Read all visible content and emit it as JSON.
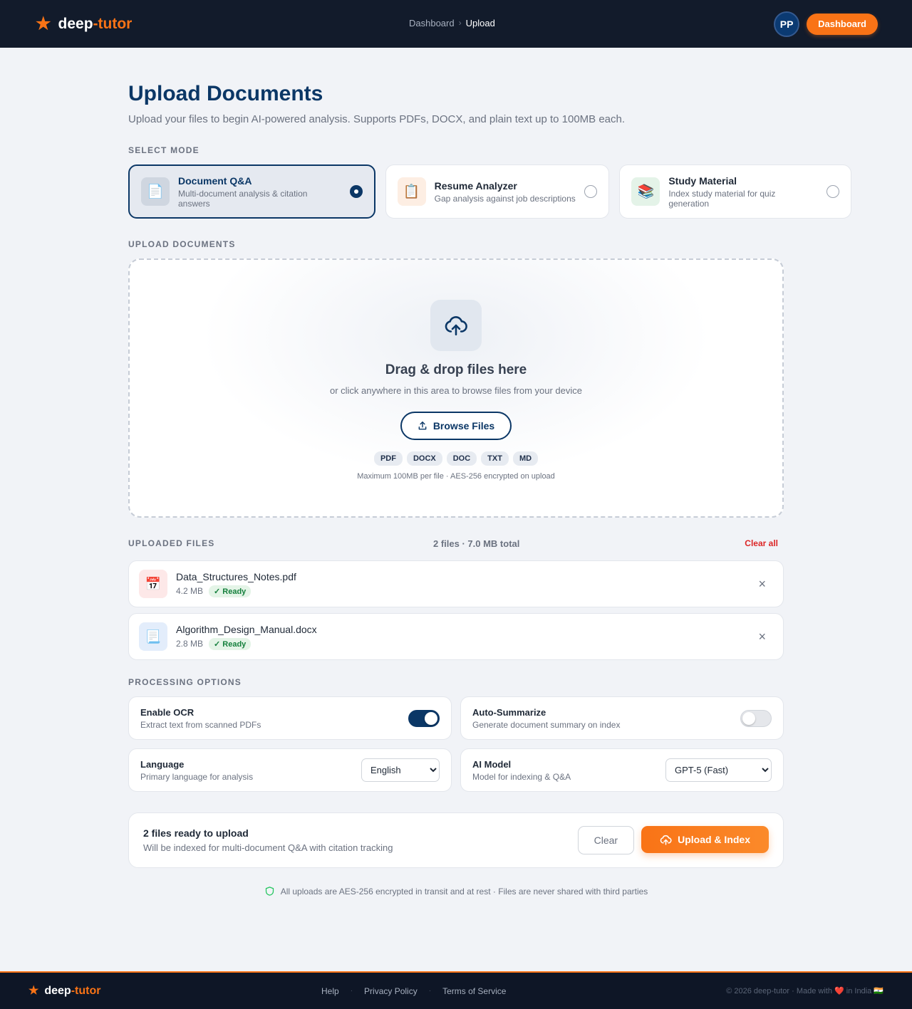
{
  "header": {
    "brand_part1": "deep",
    "brand_part2": "-tutor",
    "breadcrumb": [
      "Dashboard",
      "Upload"
    ],
    "avatar_initials": "PP",
    "dashboard_label": "Dashboard"
  },
  "page": {
    "title": "Upload Documents",
    "subtitle": "Upload your files to begin AI-powered analysis. Supports PDFs, DOCX, and plain text up to 100MB each."
  },
  "modes": {
    "label": "SELECT MODE",
    "items": [
      {
        "title": "Document Q&A",
        "desc": "Multi-document analysis & citation answers",
        "icon": "📄",
        "selected": true
      },
      {
        "title": "Resume Analyzer",
        "desc": "Gap analysis against job descriptions",
        "icon": "📋",
        "selected": false
      },
      {
        "title": "Study Material",
        "desc": "Index study material for quiz generation",
        "icon": "📚",
        "selected": false
      }
    ]
  },
  "dropzone": {
    "label": "UPLOAD DOCUMENTS",
    "title": "Drag & drop files here",
    "subtitle": "or click anywhere in this area to browse files from your device",
    "browse_label": "Browse Files",
    "types": [
      "PDF",
      "DOCX",
      "DOC",
      "TXT",
      "MD"
    ],
    "note": "Maximum 100MB per file · AES-256 encrypted on upload"
  },
  "files": {
    "label": "UPLOADED FILES",
    "summary": "2 files · 7.0 MB total",
    "clear_all": "Clear all",
    "items": [
      {
        "name": "Data_Structures_Notes.pdf",
        "size": "4.2 MB",
        "status": "✓ Ready",
        "icon": "📅"
      },
      {
        "name": "Algorithm_Design_Manual.docx",
        "size": "2.8 MB",
        "status": "✓ Ready",
        "icon": "📃"
      }
    ]
  },
  "options": {
    "label": "PROCESSING OPTIONS",
    "ocr": {
      "title": "Enable OCR",
      "desc": "Extract text from scanned PDFs",
      "on": true
    },
    "summarize": {
      "title": "Auto-Summarize",
      "desc": "Generate document summary on index",
      "on": false
    },
    "language": {
      "title": "Language",
      "desc": "Primary language for analysis",
      "value": "English"
    },
    "model": {
      "title": "AI Model",
      "desc": "Model for indexing & Q&A",
      "value": "GPT-5 (Fast)"
    }
  },
  "action": {
    "title": "2 files ready to upload",
    "subtitle": "Will be indexed for multi-document Q&A with citation tracking",
    "clear_label": "Clear",
    "upload_label": "Upload & Index"
  },
  "secure_note": "All uploads are AES-256 encrypted in transit and at rest · Files are never shared with third parties",
  "footer": {
    "links": [
      "Help",
      "Privacy Policy",
      "Terms of Service"
    ],
    "copyright": "© 2026 deep-tutor · Made with ❤️ in India 🇮🇳"
  },
  "colors": {
    "navy": "#0b3766",
    "accent": "#f97316",
    "header_bg": "#121b2b",
    "danger": "#dc2626",
    "success": "#15803d"
  }
}
